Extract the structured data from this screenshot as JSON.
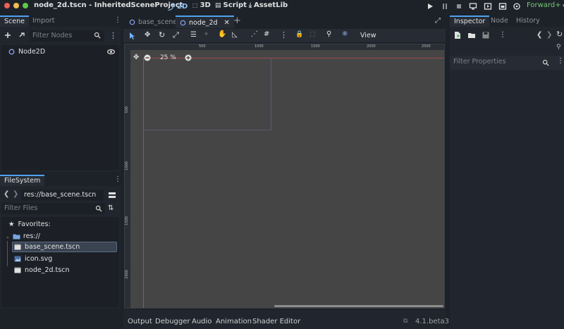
{
  "window": {
    "title": "node_2d.tscn - InheritedSceneProject"
  },
  "workspaces": [
    {
      "label": "2D",
      "active": true
    },
    {
      "label": "3D"
    },
    {
      "label": "Script"
    },
    {
      "label": "AssetLib"
    }
  ],
  "renderer": "Forward+",
  "scene_dock": {
    "tabs": [
      "Scene",
      "Import"
    ],
    "filter_placeholder": "Filter Nodes",
    "tree": [
      {
        "label": "Node2D"
      }
    ]
  },
  "filesystem_dock": {
    "tab": "FileSystem",
    "path": "res://base_scene.tscn",
    "filter_placeholder": "Filter Files",
    "favorites_label": "Favorites:",
    "root_label": "res://",
    "files": [
      "base_scene.tscn",
      "icon.svg",
      "node_2d.tscn"
    ]
  },
  "editor_tabs": [
    {
      "label": "base_scene"
    },
    {
      "label": "node_2d",
      "active": true
    }
  ],
  "toolbar": {
    "view_label": "View"
  },
  "viewport": {
    "zoom": "25 %",
    "ruler_h": [
      "500",
      "1000",
      "1500",
      "2000",
      "2500"
    ],
    "ruler_v": [
      "500",
      "1000",
      "1500",
      "2000"
    ]
  },
  "inspector_dock": {
    "tabs": [
      "Inspector",
      "Node",
      "History"
    ],
    "filter_placeholder": "Filter Properties"
  },
  "bottom_panel": {
    "tabs": [
      "Output",
      "Debugger",
      "Audio",
      "Animation",
      "Shader Editor"
    ],
    "version": "4.1.beta3"
  },
  "colors": {
    "accent": "#4fa2ef",
    "renderer": "#78c878",
    "viewport_bg": "#454545",
    "origin_y_axis": "#a14b4b"
  }
}
